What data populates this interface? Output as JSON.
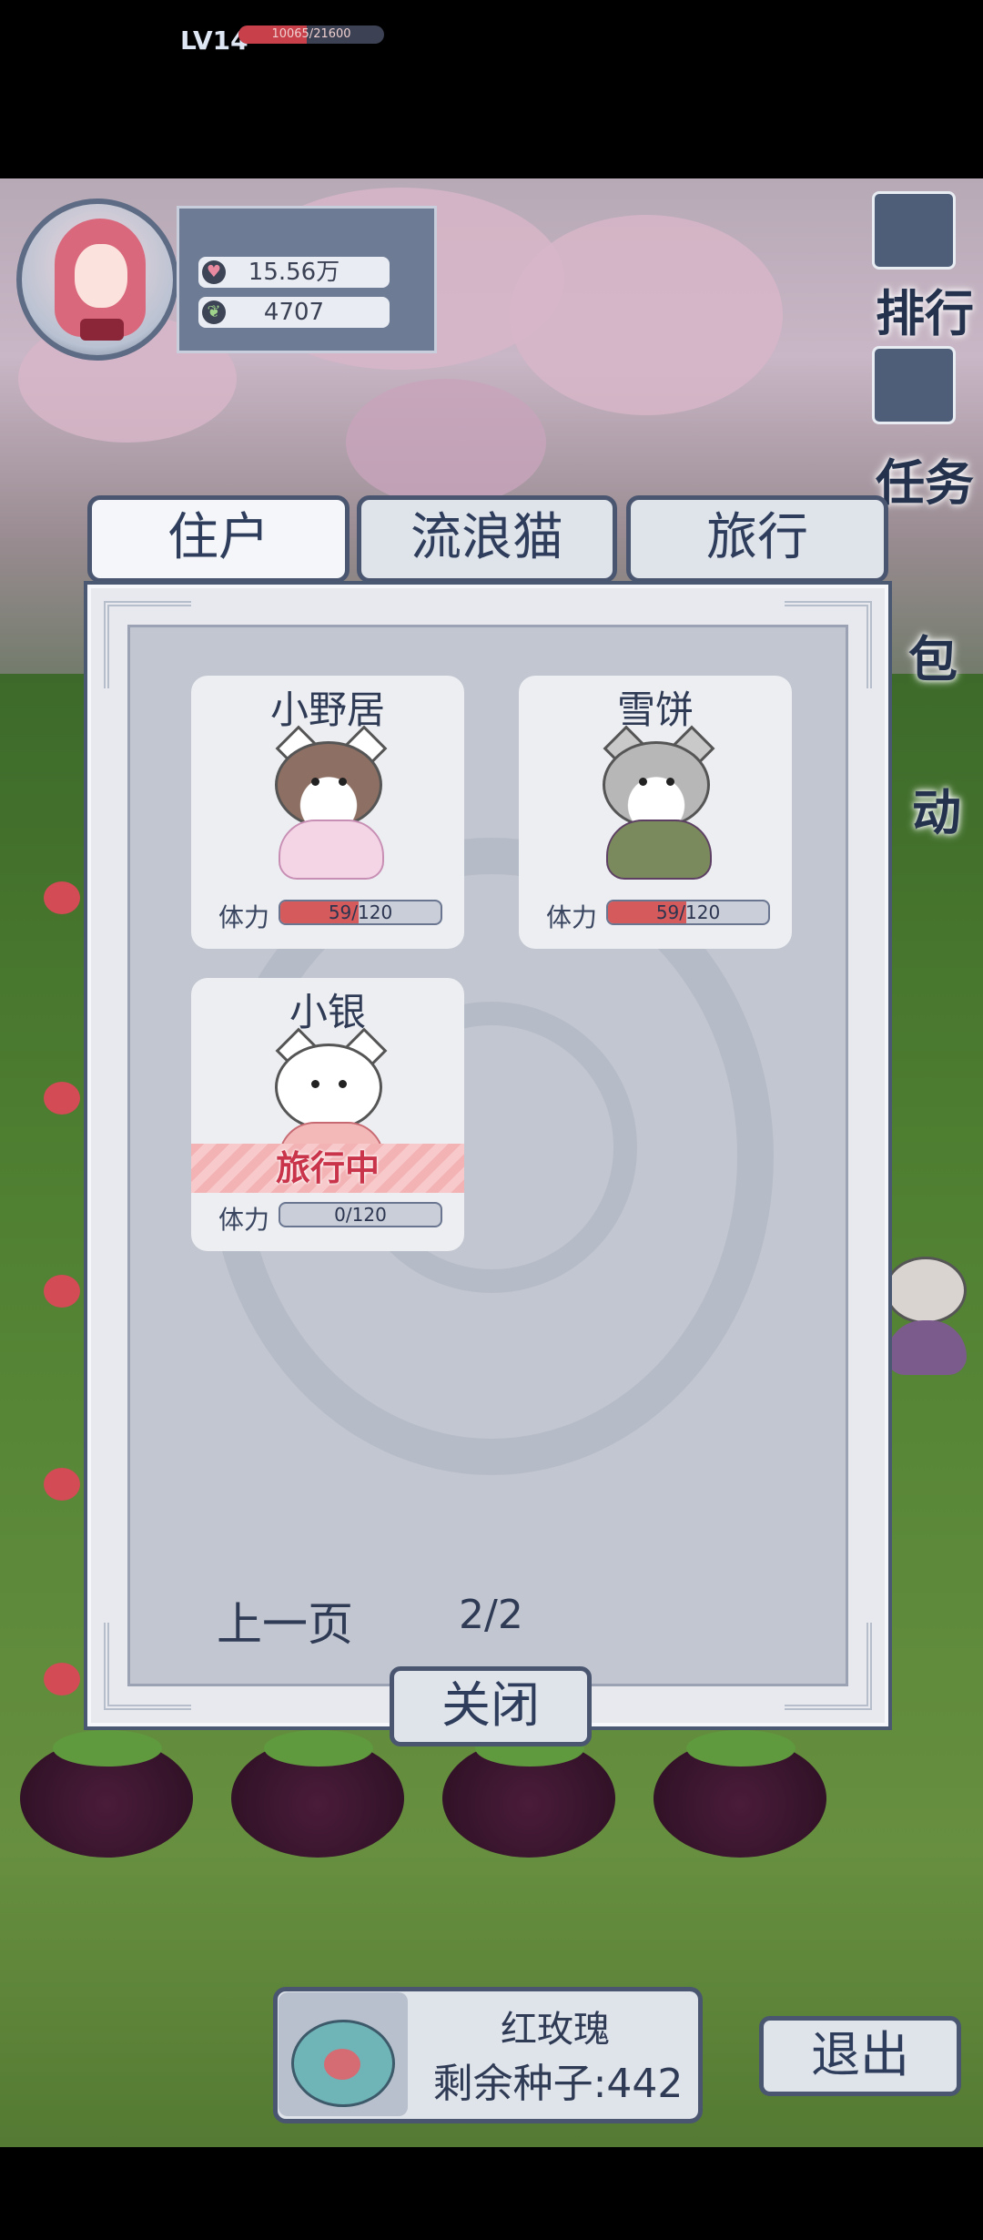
{
  "hud": {
    "level": "LV14",
    "xp_text": "10065/21600",
    "xp_progress": 0.466,
    "hearts": "15.56万",
    "leaves": "4707"
  },
  "side_menu": {
    "rank": "排行",
    "tasks": "任务",
    "bag": "包",
    "event": "动"
  },
  "tabs": [
    {
      "label": "住户",
      "active": true
    },
    {
      "label": "流浪猫",
      "active": false
    },
    {
      "label": "旅行",
      "active": false
    }
  ],
  "stamina_label": "体力",
  "cats": [
    {
      "name": "小野居",
      "stamina": "59/120",
      "stamina_fraction": 0.49,
      "status": ""
    },
    {
      "name": "雪饼",
      "stamina": "59/120",
      "stamina_fraction": 0.49,
      "status": ""
    },
    {
      "name": "小银",
      "stamina": "0/120",
      "stamina_fraction": 0,
      "status": "旅行中"
    }
  ],
  "pager": {
    "prev": "上一页",
    "page": "2/2"
  },
  "close_label": "关闭",
  "seed": {
    "name": "红玫瑰",
    "remaining": "剩余种子:442"
  },
  "exit_label": "退出",
  "colors": {
    "accent": "#4a5670",
    "stamina": "#d55a5c",
    "traveling": "#c9344a"
  }
}
